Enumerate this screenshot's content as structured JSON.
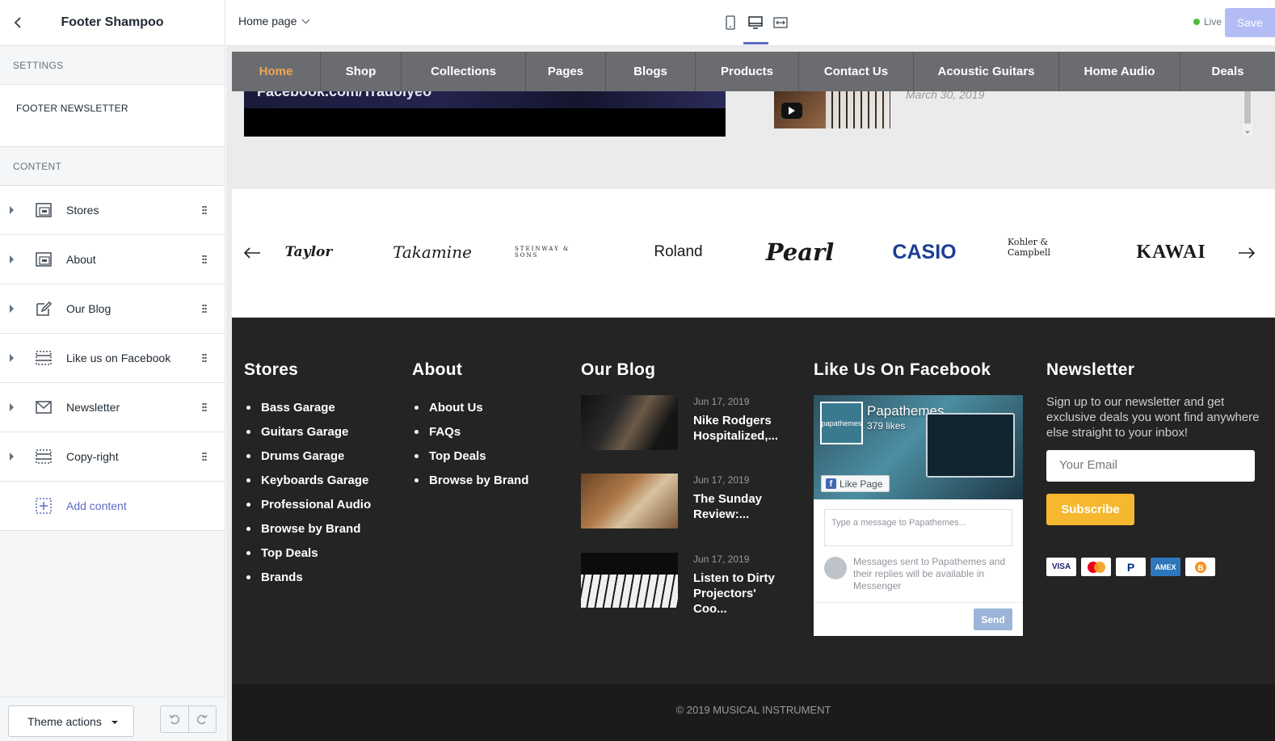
{
  "sidebar": {
    "title": "Footer Shampoo",
    "settings_label": "SETTINGS",
    "setting_item": "FOOTER NEWSLETTER",
    "content_label": "CONTENT",
    "items": [
      {
        "label": "Stores",
        "icon": "section-icon"
      },
      {
        "label": "About",
        "icon": "section-icon"
      },
      {
        "label": "Our Blog",
        "icon": "edit-icon"
      },
      {
        "label": "Like us on Facebook",
        "icon": "dashed-section-icon"
      },
      {
        "label": "Newsletter",
        "icon": "envelope-icon"
      },
      {
        "label": "Copy-right",
        "icon": "dashed-section-icon"
      }
    ],
    "add_content": "Add content",
    "theme_actions": "Theme actions"
  },
  "topbar": {
    "page_select": "Home page",
    "live_label": "Live",
    "save_label": "Save",
    "active_device": "desktop"
  },
  "preview": {
    "video_caption": "Facebook.com/Tradolyeo",
    "video_date": "March 30, 2019",
    "nav": [
      "Home",
      "Shop",
      "Collections",
      "Pages",
      "Blogs",
      "Products",
      "Contact Us",
      "Acoustic Guitars",
      "Home Audio",
      "Deals"
    ],
    "nav_active": "Home",
    "brands": [
      "Taylor",
      "Takamine",
      "STEINWAY & SONS",
      "Roland",
      "Pearl",
      "CASIO",
      "Kohler & Campbell",
      "KAWAI"
    ],
    "footer": {
      "stores": {
        "title": "Stores",
        "links": [
          "Bass Garage",
          "Guitars Garage",
          "Drums Garage",
          "Keyboards Garage",
          "Professional Audio",
          "Browse by Brand",
          "Top Deals",
          "Brands"
        ]
      },
      "about": {
        "title": "About",
        "links": [
          "About Us",
          "FAQs",
          "Top Deals",
          "Browse by Brand"
        ]
      },
      "blog": {
        "title": "Our Blog",
        "posts": [
          {
            "date": "Jun 17, 2019",
            "title": "Nike Rodgers Hospitalized,..."
          },
          {
            "date": "Jun 17, 2019",
            "title": "The Sunday Review:..."
          },
          {
            "date": "Jun 17, 2019",
            "title": "Listen to Dirty Projectors' Coo..."
          }
        ]
      },
      "facebook": {
        "title": "Like Us On Facebook",
        "page_name": "Papathemes",
        "likes": "379 likes",
        "like_button": "Like Page",
        "message_placeholder": "Type a message to Papathemes...",
        "note": "Messages sent to Papathemes and their replies will be available in Messenger",
        "send": "Send",
        "logo_text": "papathemes"
      },
      "newsletter": {
        "title": "Newsletter",
        "text": "Sign up to our newsletter and get exclusive deals you wont find anywhere else straight to your inbox!",
        "placeholder": "Your Email",
        "button": "Subscribe",
        "payments": [
          "VISA",
          "mastercard",
          "PayPal",
          "AMEX",
          "bitcoin"
        ]
      },
      "copyright": "© 2019 MUSICAL INSTRUMENT"
    }
  },
  "colors": {
    "accent": "#5c6ac4",
    "nav_active": "#f2a64f",
    "subscribe": "#f5b82e",
    "footer_bg": "#242424"
  }
}
